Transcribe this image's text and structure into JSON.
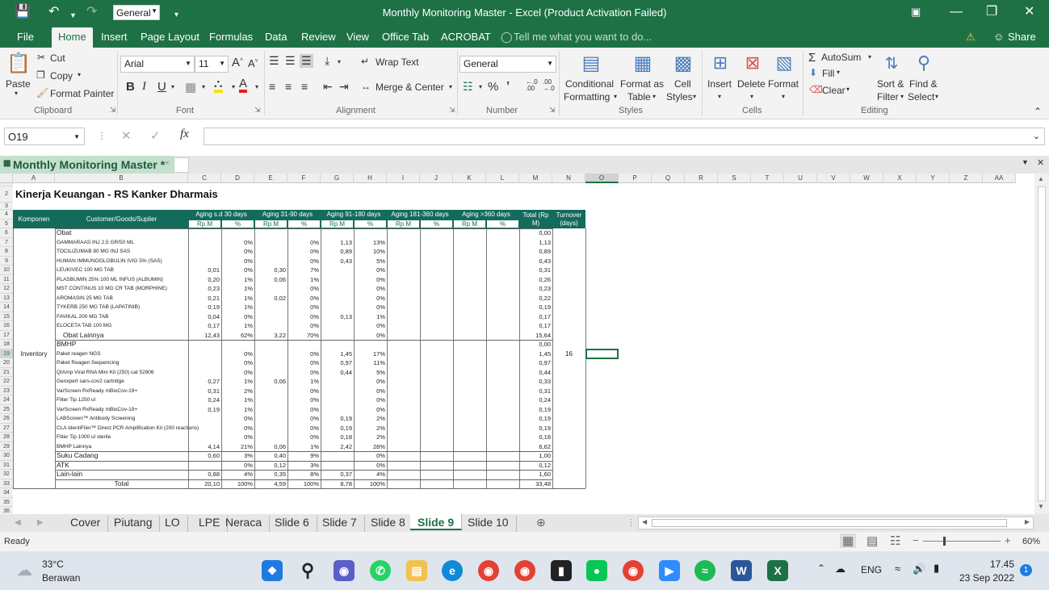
{
  "window": {
    "title": "Monthly Monitoring Master - Excel (Product Activation Failed)",
    "font_quick": "General",
    "share": "Share"
  },
  "menu": [
    "File",
    "Home",
    "Insert",
    "Page Layout",
    "Formulas",
    "Data",
    "Review",
    "View",
    "Office Tab",
    "ACROBAT"
  ],
  "tell_me": "Tell me what you want to do...",
  "ribbon": {
    "cut": "Cut",
    "copy": "Copy",
    "paste": "Paste",
    "format_painter": "Format Painter",
    "font_name": "Arial",
    "font_size": "11",
    "wrap_text": "Wrap Text",
    "merge_center": "Merge & Center",
    "number_format": "General",
    "conditional": "Conditional",
    "formatting": "Formatting",
    "format_as": "Format as",
    "table": "Table",
    "cell": "Cell",
    "styles": "Styles",
    "insert": "Insert",
    "delete": "Delete",
    "format": "Format",
    "autosum": "AutoSum",
    "fill": "Fill",
    "clear": "Clear",
    "sort": "Sort &",
    "filter": "Filter",
    "find": "Find &",
    "select": "Select",
    "groups": [
      "Clipboard",
      "Font",
      "Alignment",
      "Number",
      "Styles",
      "Cells",
      "Editing"
    ]
  },
  "namebox": "O19",
  "workbook_tab": "Monthly Monitoring Master *",
  "columns": [
    "A",
    "B",
    "C",
    "D",
    "E",
    "F",
    "G",
    "H",
    "I",
    "J",
    "K",
    "L",
    "M",
    "N",
    "O",
    "P",
    "Q",
    "R",
    "S",
    "T",
    "U",
    "V",
    "W",
    "X",
    "Y",
    "Z",
    "AA"
  ],
  "sheet": {
    "title": "Kinerja Keuangan - RS Kanker Dharmais",
    "headers": {
      "komponen": "Komponen",
      "customer": "Customer/Goods/Suplier",
      "aging1": "Aging s.d 30 days",
      "aging2": "Aging 31-90 days",
      "aging3": "Aging 91-180 days",
      "aging4": "Aging 181-360 days",
      "aging5": "Aging >360 days",
      "total": "Total (Rp M)",
      "turnover": "Turnover (days)",
      "rpm": "Rp M",
      "pct": "%"
    },
    "komponen_value": "Inventory",
    "turnover_value": "16",
    "rows": [
      {
        "r": "6",
        "b": "Obat",
        "c": "",
        "d": "",
        "e": "",
        "f": "",
        "g": "",
        "h": "",
        "m": "0,00",
        "big": true
      },
      {
        "r": "7",
        "b": "GAMMARAAS INJ 2,5 GR/50 ML",
        "c": "",
        "d": "0%",
        "e": "",
        "f": "0%",
        "g": "1,13",
        "h": "13%",
        "m": "1,13"
      },
      {
        "r": "8",
        "b": "TOCILIZUMAB 80 MG INJ SAS",
        "c": "",
        "d": "0%",
        "e": "",
        "f": "0%",
        "g": "0,89",
        "h": "10%",
        "m": "0,89"
      },
      {
        "r": "9",
        "b": "HUMAN IMMUNOGLOBULIN IVIG 5% (SAS)",
        "c": "",
        "d": "0%",
        "e": "",
        "f": "0%",
        "g": "0,43",
        "h": "5%",
        "m": "0,43"
      },
      {
        "r": "10",
        "b": "LEUKIVEC 100 MG TAB",
        "c": "0,01",
        "d": "0%",
        "e": "0,30",
        "f": "7%",
        "g": "",
        "h": "0%",
        "m": "0,31"
      },
      {
        "r": "11",
        "b": "PLASBUMIN 25% 100 ML INFUS (ALBUMIN)",
        "c": "0,20",
        "d": "1%",
        "e": "0,06",
        "f": "1%",
        "g": "",
        "h": "0%",
        "m": "0,26"
      },
      {
        "r": "12",
        "b": "MST CONTINUS 10 MG CR TAB (MORPHINE)",
        "c": "0,23",
        "d": "1%",
        "e": "",
        "f": "0%",
        "g": "",
        "h": "0%",
        "m": "0,23"
      },
      {
        "r": "13",
        "b": "AROMASIN 25 MG TAB",
        "c": "0,21",
        "d": "1%",
        "e": "0,02",
        "f": "0%",
        "g": "",
        "h": "0%",
        "m": "0,22"
      },
      {
        "r": "14",
        "b": "TYKERB 250 MG TAB (LAPATINIB)",
        "c": "0,19",
        "d": "1%",
        "e": "",
        "f": "0%",
        "g": "",
        "h": "0%",
        "m": "0,19"
      },
      {
        "r": "15",
        "b": "FAVIKAL 200 MG TAB",
        "c": "0,04",
        "d": "0%",
        "e": "",
        "f": "0%",
        "g": "0,13",
        "h": "1%",
        "m": "0,17"
      },
      {
        "r": "16",
        "b": "ELOCETA TAB 100 MG",
        "c": "0,17",
        "d": "1%",
        "e": "",
        "f": "0%",
        "g": "",
        "h": "0%",
        "m": "0,17"
      },
      {
        "r": "17",
        "b": "Obat Lainnya",
        "c": "12,43",
        "d": "62%",
        "e": "3,22",
        "f": "70%",
        "g": "",
        "h": "0%",
        "m": "15,64",
        "big": true,
        "indent": true
      },
      {
        "r": "18",
        "b": "BMHP",
        "c": "",
        "d": "",
        "e": "",
        "f": "",
        "g": "",
        "h": "",
        "m": "0,00",
        "big": true
      },
      {
        "r": "19",
        "b": "Paket reagen NGS",
        "c": "",
        "d": "0%",
        "e": "",
        "f": "0%",
        "g": "1,45",
        "h": "17%",
        "m": "1,45"
      },
      {
        "r": "20",
        "b": "Paket Reagen Sequencing",
        "c": "",
        "d": "0%",
        "e": "",
        "f": "0%",
        "g": "0,97",
        "h": "11%",
        "m": "0,97"
      },
      {
        "r": "21",
        "b": "QIAmp Viral RNA Mini Kit (250) cat 52906",
        "c": "",
        "d": "0%",
        "e": "",
        "f": "0%",
        "g": "0,44",
        "h": "5%",
        "m": "0,44"
      },
      {
        "r": "22",
        "b": "Genxpert sars-cov2 cartridge",
        "c": "0,27",
        "d": "1%",
        "e": "0,06",
        "f": "1%",
        "g": "",
        "h": "0%",
        "m": "0,33"
      },
      {
        "r": "23",
        "b": "VarScreen RxReady mBioCov-19+",
        "c": "0,31",
        "d": "2%",
        "e": "",
        "f": "0%",
        "g": "",
        "h": "0%",
        "m": "0,31"
      },
      {
        "r": "24",
        "b": "Filter Tip 1250 ul",
        "c": "0,24",
        "d": "1%",
        "e": "",
        "f": "0%",
        "g": "",
        "h": "0%",
        "m": "0,24"
      },
      {
        "r": "25",
        "b": "VarScreen RxReady mBioCov-19+",
        "c": "0,19",
        "d": "1%",
        "e": "",
        "f": "0%",
        "g": "",
        "h": "0%",
        "m": "0,19"
      },
      {
        "r": "26",
        "b": "LABScreen™ Antibody Screening",
        "c": "",
        "d": "0%",
        "e": "",
        "f": "0%",
        "g": "0,19",
        "h": "2%",
        "m": "0,19"
      },
      {
        "r": "27",
        "b": "CLA IdentiFiler™ Direct PCR Amplification Kit (200 reactions)",
        "c": "",
        "d": "0%",
        "e": "",
        "f": "0%",
        "g": "0,19",
        "h": "2%",
        "m": "0,19"
      },
      {
        "r": "28",
        "b": "Filter Tip 1000 ul sterile",
        "c": "",
        "d": "0%",
        "e": "",
        "f": "0%",
        "g": "0,18",
        "h": "2%",
        "m": "0,18"
      },
      {
        "r": "29",
        "b": "BMHP Lainnya",
        "c": "4,14",
        "d": "21%",
        "e": "0,06",
        "f": "1%",
        "g": "2,42",
        "h": "28%",
        "m": "6,62"
      },
      {
        "r": "30",
        "b": "Suku Cadang",
        "c": "0,60",
        "d": "3%",
        "e": "0,40",
        "f": "9%",
        "g": "",
        "h": "0%",
        "m": "1,00",
        "big": true
      },
      {
        "r": "31",
        "b": "ATK",
        "c": "",
        "d": "0%",
        "e": "0,12",
        "f": "3%",
        "g": "",
        "h": "0%",
        "m": "0,12",
        "big": true
      },
      {
        "r": "32",
        "b": "Lain-lain",
        "c": "0,88",
        "d": "4%",
        "e": "0,35",
        "f": "8%",
        "g": "0,37",
        "h": "4%",
        "m": "1,60",
        "big": true
      },
      {
        "r": "33",
        "b": "Total",
        "c": "20,10",
        "d": "100%",
        "e": "4,59",
        "f": "100%",
        "g": "8,78",
        "h": "100%",
        "m": "33,48",
        "big": true,
        "center": true
      }
    ]
  },
  "sheet_tabs": [
    "Cover",
    "Piutang",
    "LO",
    "LPE",
    "Neraca",
    "Slide 6",
    "Slide 7",
    "Slide 8",
    "Slide 9",
    "Slide 10"
  ],
  "active_sheet": "Slide 9",
  "status": {
    "ready": "Ready",
    "zoom": "60%"
  },
  "taskbar": {
    "temp": "33°C",
    "weather": "Berawan",
    "lang": "ENG",
    "time": "17.45",
    "date": "23 Sep 2022",
    "notif": "1"
  }
}
